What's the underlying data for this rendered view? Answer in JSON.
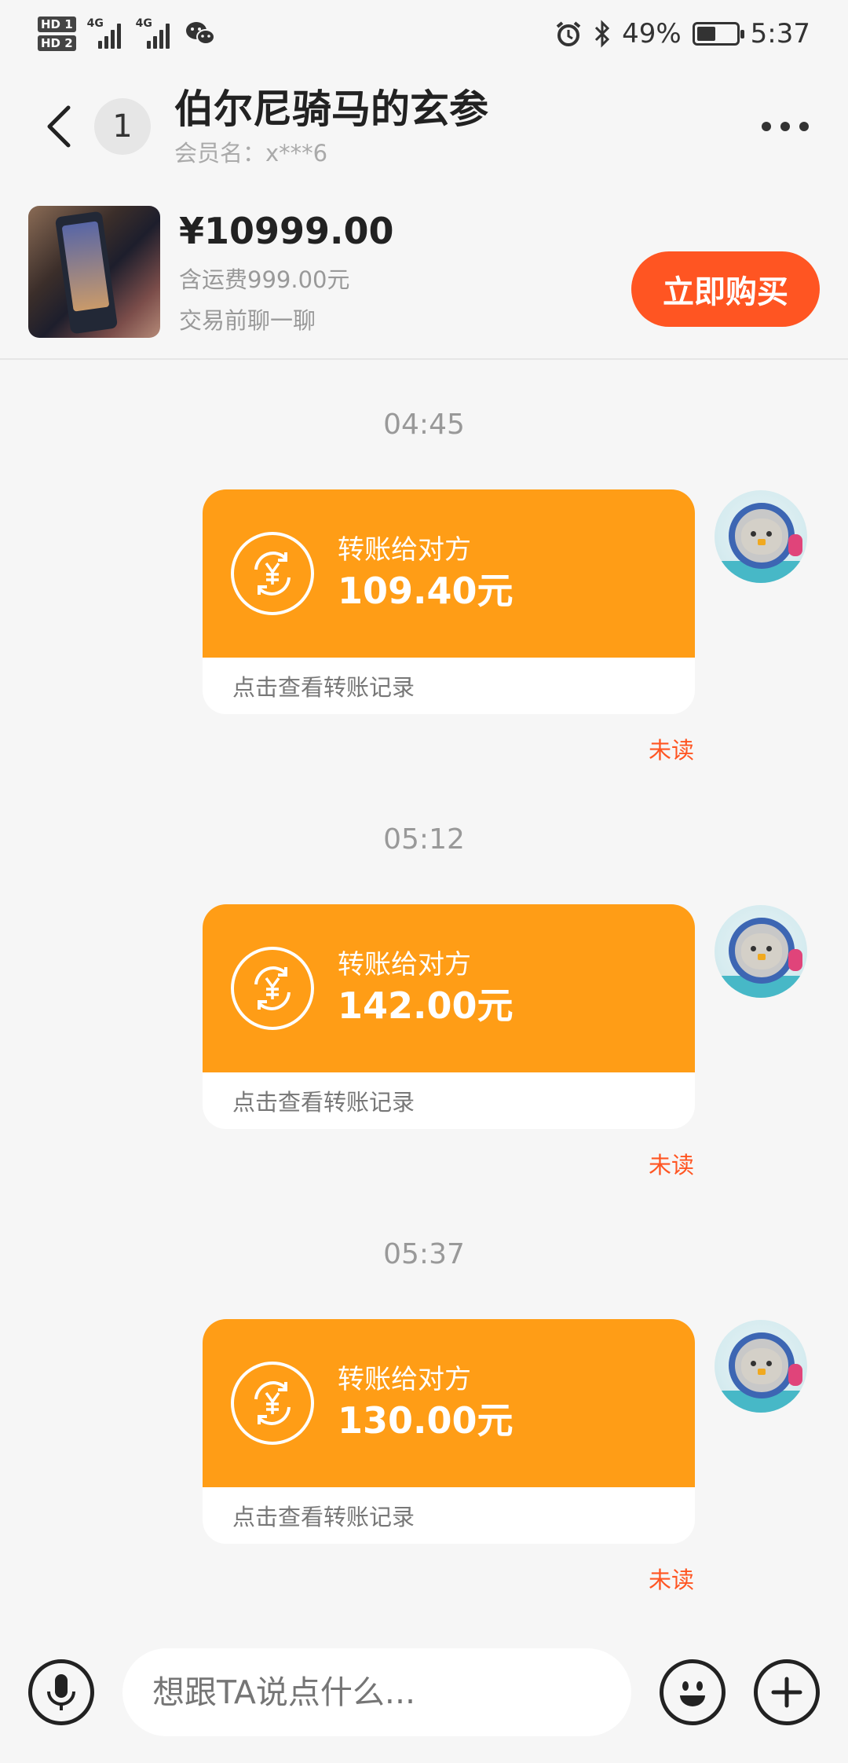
{
  "status_bar": {
    "sim1": "HD 1",
    "sim2": "HD 2",
    "net1": "4G",
    "net2": "4G",
    "battery": "49%",
    "battery_level": 0.49,
    "time": "5:37",
    "icons": [
      "wechat-icon",
      "alarm-icon",
      "bluetooth-icon",
      "battery-icon"
    ]
  },
  "header": {
    "unread_count": "1",
    "title": "伯尔尼骑马的玄参",
    "member": "会员名：x***6"
  },
  "product": {
    "price": "¥10999.00",
    "shipping": "含运费999.00元",
    "chat_first": "交易前聊一聊",
    "buy_label": "立即购买"
  },
  "messages": [
    {
      "time": "04:45",
      "label": "转账给对方",
      "amount": "109.40元",
      "footer": "点击查看转账记录",
      "status": "未读"
    },
    {
      "time": "05:12",
      "label": "转账给对方",
      "amount": "142.00元",
      "footer": "点击查看转账记录",
      "status": "未读"
    },
    {
      "time": "05:37",
      "label": "转账给对方",
      "amount": "130.00元",
      "footer": "点击查看转账记录",
      "status": "未读"
    }
  ],
  "input_bar": {
    "placeholder": "想跟TA说点什么..."
  },
  "colors": {
    "accent": "#ff5522",
    "transfer_card": "#ff9d16",
    "background": "#f6f6f6"
  }
}
